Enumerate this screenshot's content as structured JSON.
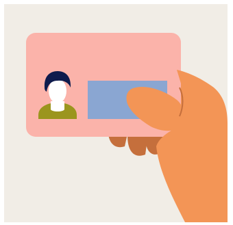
{
  "illustration": {
    "subject": "hand-holding-id-card",
    "icons": [
      "id-card-icon",
      "person-icon",
      "hand-icon"
    ]
  },
  "colors": {
    "page_background": "#ffffff",
    "background": "#f1ede6",
    "card": "#fbb3aa",
    "photo_head": "#0e1b4d",
    "photo_face": "#ffffff",
    "photo_shoulders": "#9b951e",
    "chip": "#8aa6d2",
    "hand": "#f39556",
    "hand_shadow": "#c56f3c"
  }
}
